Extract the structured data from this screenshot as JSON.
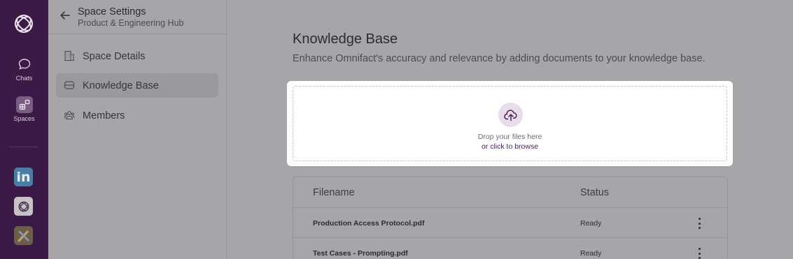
{
  "rail": {
    "logo": "omnifact-logo",
    "chats_label": "Chats",
    "spaces_label": "Spaces",
    "apps": [
      {
        "name": "linkedin-app-icon",
        "text": "in"
      },
      {
        "name": "omnifact-app-icon"
      },
      {
        "name": "tools-app-icon"
      }
    ]
  },
  "settings": {
    "title": "Space Settings",
    "subtitle": "Product & Engineering Hub",
    "nav": [
      {
        "label": "Space Details",
        "icon": "building-icon"
      },
      {
        "label": "Knowledge Base",
        "icon": "database-icon",
        "active": true
      },
      {
        "label": "Members",
        "icon": "members-icon"
      }
    ]
  },
  "main": {
    "title": "Knowledge Base",
    "description": "Enhance Omnifact's accuracy and relevance by adding documents to your knowledge base.",
    "upload": {
      "icon": "cloud-upload-icon",
      "drop_text": "Drop your files here",
      "browse_text": "or click to browse"
    },
    "table": {
      "headers": {
        "filename": "Filename",
        "status": "Status"
      },
      "rows": [
        {
          "filename": "Production Access Protocol.pdf",
          "status": "Ready"
        },
        {
          "filename": "Test Cases - Prompting.pdf",
          "status": "Ready"
        }
      ]
    }
  },
  "colors": {
    "rail": "#3b1a45",
    "accent": "#4a1e59",
    "overlay_bg": "#a7a5a9",
    "card": "#ffffff"
  }
}
